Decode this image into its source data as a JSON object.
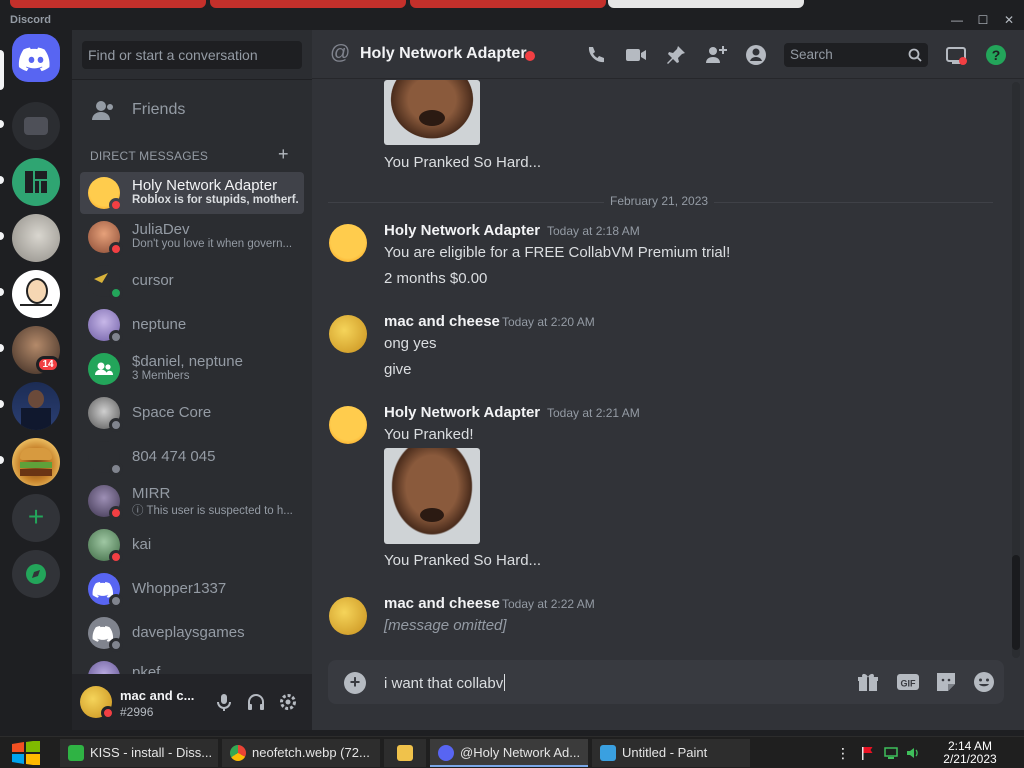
{
  "window": {
    "app_name": "Discord"
  },
  "dm_sidebar": {
    "search_placeholder": "Find or start a conversation",
    "friends_label": "Friends",
    "direct_messages_header": "DIRECT MESSAGES",
    "items": [
      {
        "name": "Holy Network Adapter",
        "subtitle": "Roblox is for stupids, motherf...",
        "status": "dnd",
        "selected": true
      },
      {
        "name": "JuliaDev",
        "subtitle": "Don't you love it when govern...",
        "status": "dnd"
      },
      {
        "name": "cursor",
        "subtitle": "",
        "status": "online"
      },
      {
        "name": "neptune",
        "subtitle": "",
        "status": "offline"
      },
      {
        "name": "$daniel, neptune",
        "subtitle": "3 Members",
        "status": "group"
      },
      {
        "name": "Space Core",
        "subtitle": "",
        "status": "offline"
      },
      {
        "name": "804 474 045",
        "subtitle": "",
        "status": "offline"
      },
      {
        "name": "MIRR",
        "subtitle": "ⓘ This user is suspected to h...",
        "status": "dnd"
      },
      {
        "name": "kai",
        "subtitle": "",
        "status": "dnd"
      },
      {
        "name": "Whopper1337",
        "subtitle": "",
        "status": "offline"
      },
      {
        "name": "daveplaysgames",
        "subtitle": "",
        "status": "offline"
      },
      {
        "name": "pkef",
        "subtitle": "",
        "status": "offline"
      }
    ]
  },
  "servers": {
    "mention_badge": "14"
  },
  "user_panel": {
    "name": "mac and c...",
    "tag": "#2996"
  },
  "channel_header": {
    "title": "Holy Network Adapter",
    "search_placeholder": "Search"
  },
  "chat": {
    "date_divider": "February 21, 2023",
    "top_caption": "You Pranked So Hard...",
    "messages": [
      {
        "author": "Holy Network Adapter",
        "timestamp": "Today at 2:18 AM",
        "lines": [
          "You are eligible for a FREE CollabVM Premium trial!",
          "2 months $0.00"
        ]
      },
      {
        "author": "mac and cheese",
        "timestamp": "Today at 2:20 AM",
        "lines": [
          "ong yes",
          "give"
        ]
      },
      {
        "author": "Holy Network Adapter",
        "timestamp": "Today at 2:21 AM",
        "lines": [
          "You Pranked!"
        ],
        "image_caption": "You Pranked So Hard..."
      },
      {
        "author": "mac and cheese",
        "timestamp": "Today at 2:22 AM",
        "lines": [
          "[message omitted]"
        ]
      }
    ]
  },
  "composer": {
    "text": "i want that collabv"
  },
  "taskbar": {
    "tasks": [
      {
        "label": "KISS - install - Diss...",
        "icon_color": "#2fb344"
      },
      {
        "label": "neofetch.webp (72...",
        "icon_color": "#e8b73d"
      },
      {
        "label": "",
        "icon_color": "#f0c24b"
      },
      {
        "label": "@Holy Network Ad...",
        "icon_color": "#5865f2"
      },
      {
        "label": "Untitled - Paint",
        "icon_color": "#3aa0e0"
      }
    ],
    "time": "2:14 AM",
    "date": "2/21/2023"
  }
}
